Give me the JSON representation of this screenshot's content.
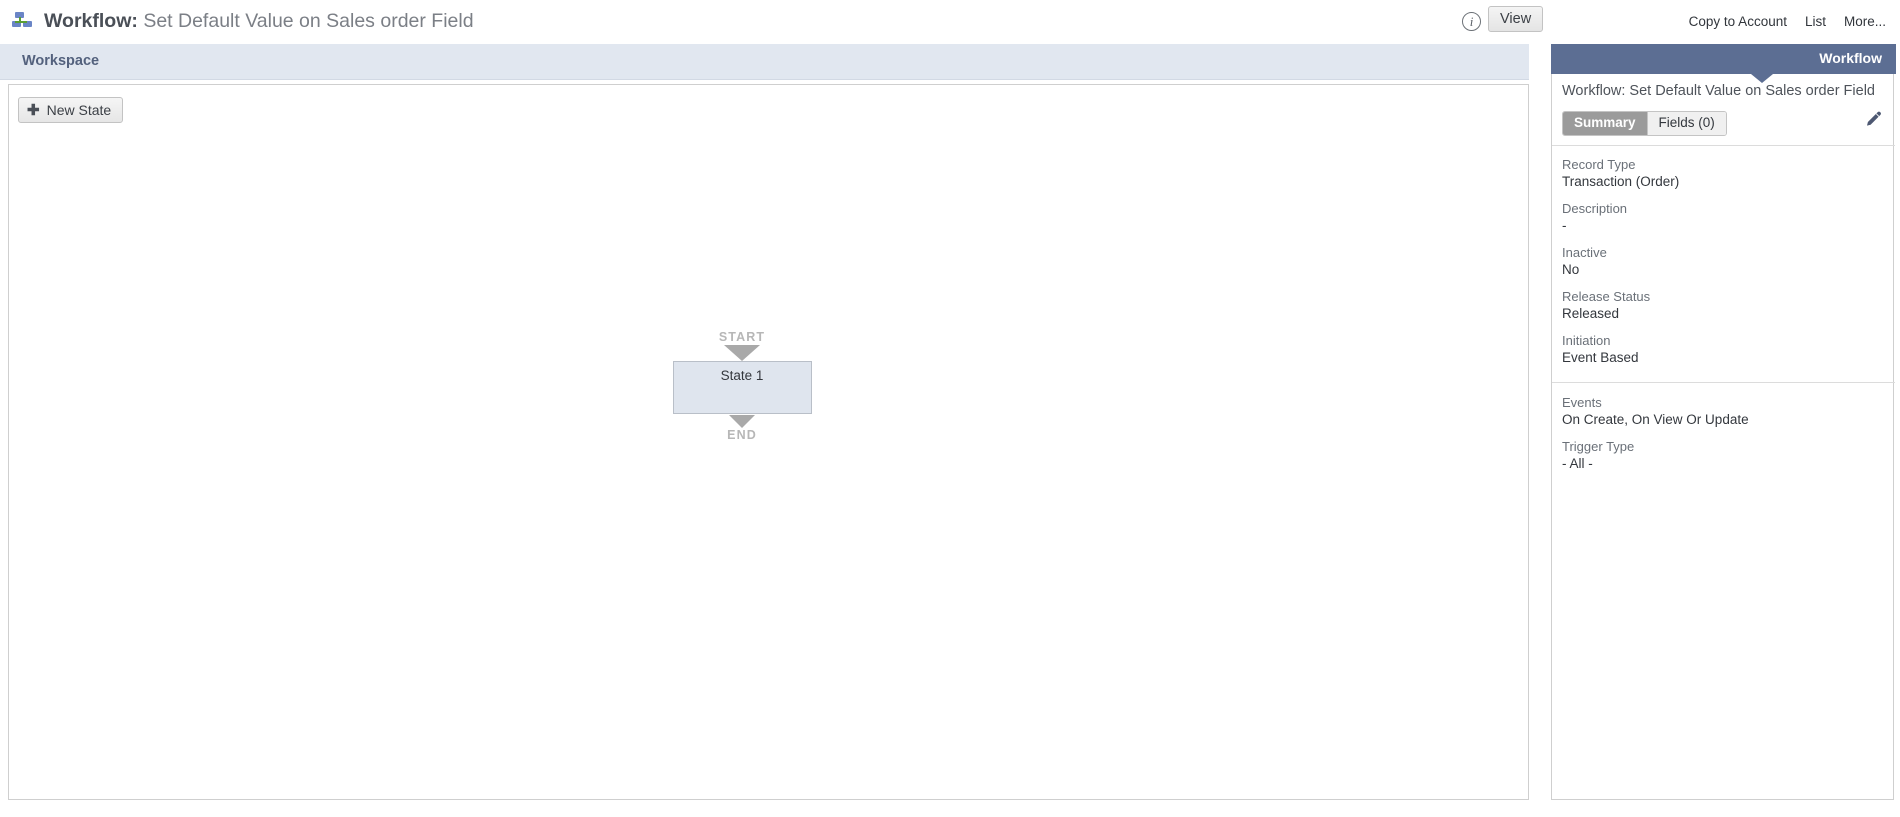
{
  "header": {
    "icon": "workflow-hierarchy-icon",
    "title_prefix": "Workflow:",
    "title_name": "Set Default Value on Sales order Field",
    "info_glyph": "i",
    "view_button": "View",
    "links": [
      {
        "label": "Copy to Account"
      },
      {
        "label": "List"
      },
      {
        "label": "More..."
      }
    ]
  },
  "workspace": {
    "header_title": "Workspace",
    "new_state_button": "New State",
    "new_state_icon": "plus-icon",
    "diagram": {
      "start_label": "START",
      "end_label": "END",
      "states": [
        {
          "label": "State 1"
        }
      ]
    }
  },
  "side_panel": {
    "panel_title": "Workflow",
    "record_title": "Workflow: Set Default Value on Sales order Field",
    "tabs": [
      {
        "label": "Summary",
        "active": true
      },
      {
        "label": "Fields (0)",
        "active": false
      }
    ],
    "edit_icon": "pencil-icon",
    "fields_group_1": [
      {
        "label": "Record Type",
        "value": "Transaction (Order)"
      },
      {
        "label": "Description",
        "value": "-"
      },
      {
        "label": "Inactive",
        "value": "No"
      },
      {
        "label": "Release Status",
        "value": "Released"
      },
      {
        "label": "Initiation",
        "value": "Event Based"
      }
    ],
    "fields_group_2": [
      {
        "label": "Events",
        "value": "On Create, On View Or Update"
      },
      {
        "label": "Trigger Type",
        "value": "- All -"
      }
    ]
  },
  "colors": {
    "panel_header": "#5c6e93",
    "workspace_header": "#e1e7f0",
    "state_box": "#dfe5ee",
    "arrow_gray": "#a9a9a9"
  }
}
